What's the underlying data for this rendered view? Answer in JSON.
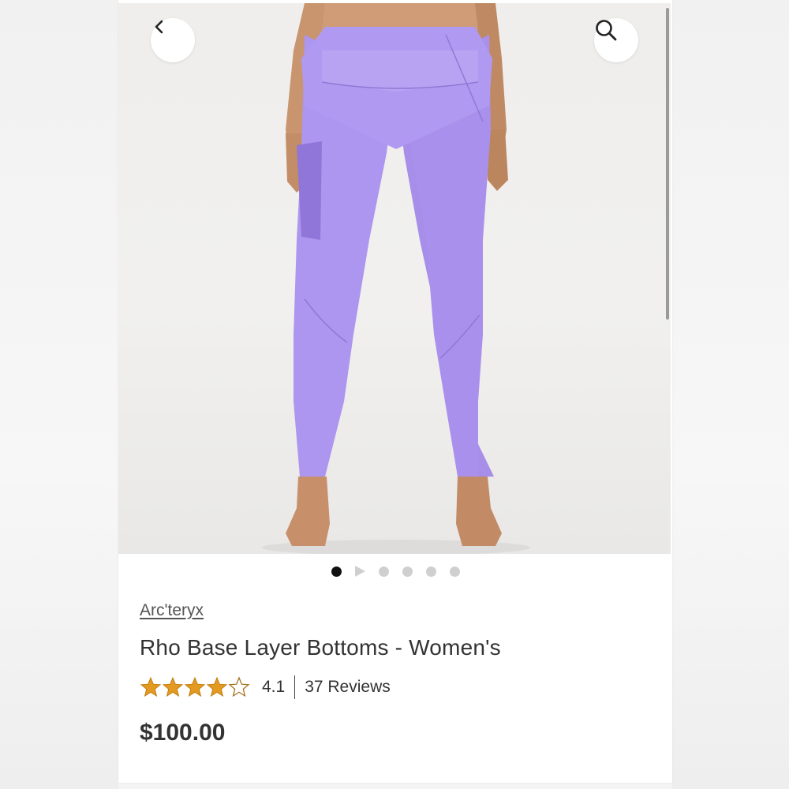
{
  "navigation": {
    "back_icon": "chevron-left-icon",
    "search_icon": "search-icon"
  },
  "gallery": {
    "image_count": 6,
    "active_index": 0,
    "video_index": 1
  },
  "product": {
    "brand": "Arc'teryx",
    "name": "Rho Base Layer Bottoms - Women's",
    "rating": "4.1",
    "rating_value": 4.1,
    "rating_max": 5,
    "reviews": "37 Reviews",
    "price": "$100.00"
  },
  "colors": {
    "star": "#e39a21",
    "legging": "#ad96ef",
    "active_dot": "#111111",
    "inactive_dot": "#cfcfcf"
  }
}
